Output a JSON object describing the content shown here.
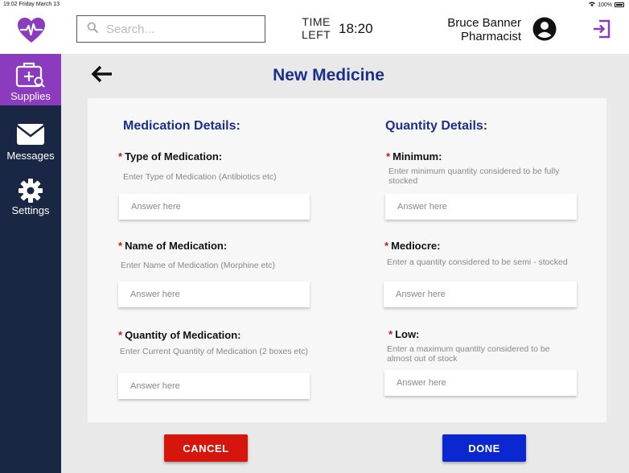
{
  "status_bar": {
    "time_date": "19:02  Friday March 13",
    "battery": "100%"
  },
  "header": {
    "search_placeholder": "Search...",
    "time_left_line1": "TIME",
    "time_left_line2": "LEFT",
    "time_left_value": "18:20",
    "user_name": "Bruce Banner",
    "user_role": "Pharmacist"
  },
  "sidebar": {
    "items": [
      {
        "label": "Supplies",
        "icon": "medical-kit-icon",
        "active": true
      },
      {
        "label": "Messages",
        "icon": "envelope-icon",
        "active": false
      },
      {
        "label": "Settings",
        "icon": "gear-icon",
        "active": false
      }
    ]
  },
  "page": {
    "title": "New Medicine"
  },
  "medication": {
    "title": "Medication Details:",
    "fields": [
      {
        "label": "Type of Medication:",
        "hint": "Enter Type of Medication (Antibiotics etc)",
        "placeholder": "Answer here"
      },
      {
        "label": "Name of Medication:",
        "hint": "Enter Name of Medication (Morphine etc)",
        "placeholder": "Answer here"
      },
      {
        "label": "Quantity of Medication:",
        "hint": "Enter Current Quantity of Medication (2 boxes etc)",
        "placeholder": "Answer here"
      }
    ]
  },
  "quantity": {
    "title": "Quantity Details:",
    "fields": [
      {
        "label": "Minimum:",
        "hint": "Enter minimum quantity  considered to be fully stocked",
        "placeholder": "Answer here"
      },
      {
        "label": "Mediocre:",
        "hint": "Enter a quantity  considered to be semi - stocked",
        "placeholder": "Answer here"
      },
      {
        "label": "Low:",
        "hint": "Enter a maximum quantity  considered to be almost out of stock",
        "placeholder": "Answer here"
      }
    ]
  },
  "required_marker": "*",
  "buttons": {
    "cancel": "CANCEL",
    "done": "DONE"
  },
  "colors": {
    "brand_purple": "#8b3bbd",
    "sidebar_navy": "#1a2744",
    "heading_blue": "#1d2f8a",
    "cancel_red": "#d6160c",
    "done_blue": "#0a27d0",
    "required_red": "#d01818"
  }
}
